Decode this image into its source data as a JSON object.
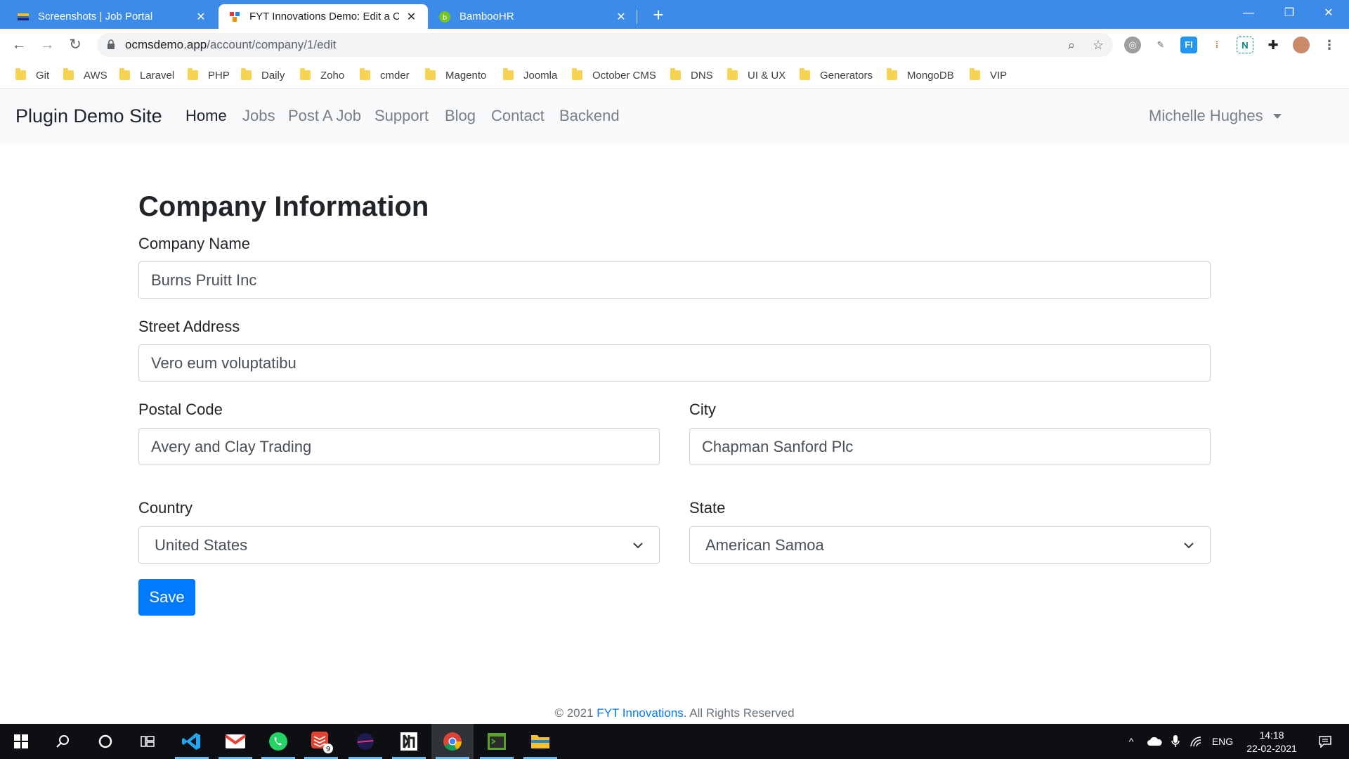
{
  "browser": {
    "tabs": [
      {
        "title": "Screenshots | Job Portal",
        "active": false
      },
      {
        "title": "FYT Innovations Demo: Edit a Co",
        "active": true
      },
      {
        "title": "BambooHR",
        "active": false
      }
    ],
    "new_tab_glyph": "+",
    "address": {
      "host": "ocmsdemo.app",
      "path": "/account/company/1/edit"
    },
    "bookmarks": [
      "Git",
      "AWS",
      "Laravel",
      "PHP",
      "Daily",
      "Zoho",
      "cmder",
      "Magento",
      "Joomla",
      "October CMS",
      "DNS",
      "UI & UX",
      "Generators",
      "MongoDB",
      "VIP"
    ]
  },
  "site": {
    "brand": "Plugin Demo Site",
    "nav": [
      {
        "label": "Home",
        "active": true
      },
      {
        "label": "Jobs",
        "active": false
      },
      {
        "label": "Post A Job",
        "active": false
      },
      {
        "label": "Support",
        "active": false
      },
      {
        "label": "Blog",
        "active": false
      },
      {
        "label": "Contact",
        "active": false
      },
      {
        "label": "Backend",
        "active": false
      }
    ],
    "user": "Michelle Hughes"
  },
  "form": {
    "title": "Company Information",
    "company_name": {
      "label": "Company Name",
      "value": "Burns Pruitt Inc"
    },
    "street_address": {
      "label": "Street Address",
      "value": "Vero eum voluptatibu"
    },
    "postal_code": {
      "label": "Postal Code",
      "value": "Avery and Clay Trading"
    },
    "city": {
      "label": "City",
      "value": "Chapman Sanford Plc"
    },
    "country": {
      "label": "Country",
      "value": "United States"
    },
    "state": {
      "label": "State",
      "value": "American Samoa"
    },
    "save_label": "Save"
  },
  "footer": {
    "prefix": "© 2021 ",
    "link": "FYT Innovations",
    "suffix": ". All Rights Reserved"
  },
  "taskbar": {
    "apps": [
      "start-icon",
      "search-icon",
      "cortana-icon",
      "task-view-icon",
      "vscode-icon",
      "gmail-icon",
      "whatsapp-icon",
      "todoist-icon",
      "app-icon",
      "app-icon",
      "chrome-icon",
      "terminal-icon",
      "file-explorer-icon"
    ],
    "todoist_badge": "9",
    "language": "ENG",
    "time": "14:18",
    "date": "22-02-2021"
  },
  "colors": {
    "tab_strip": "#3c8be8",
    "primary": "#007bff",
    "navbar_bg": "#f8f9fa",
    "taskbar": "#0d0f12"
  }
}
